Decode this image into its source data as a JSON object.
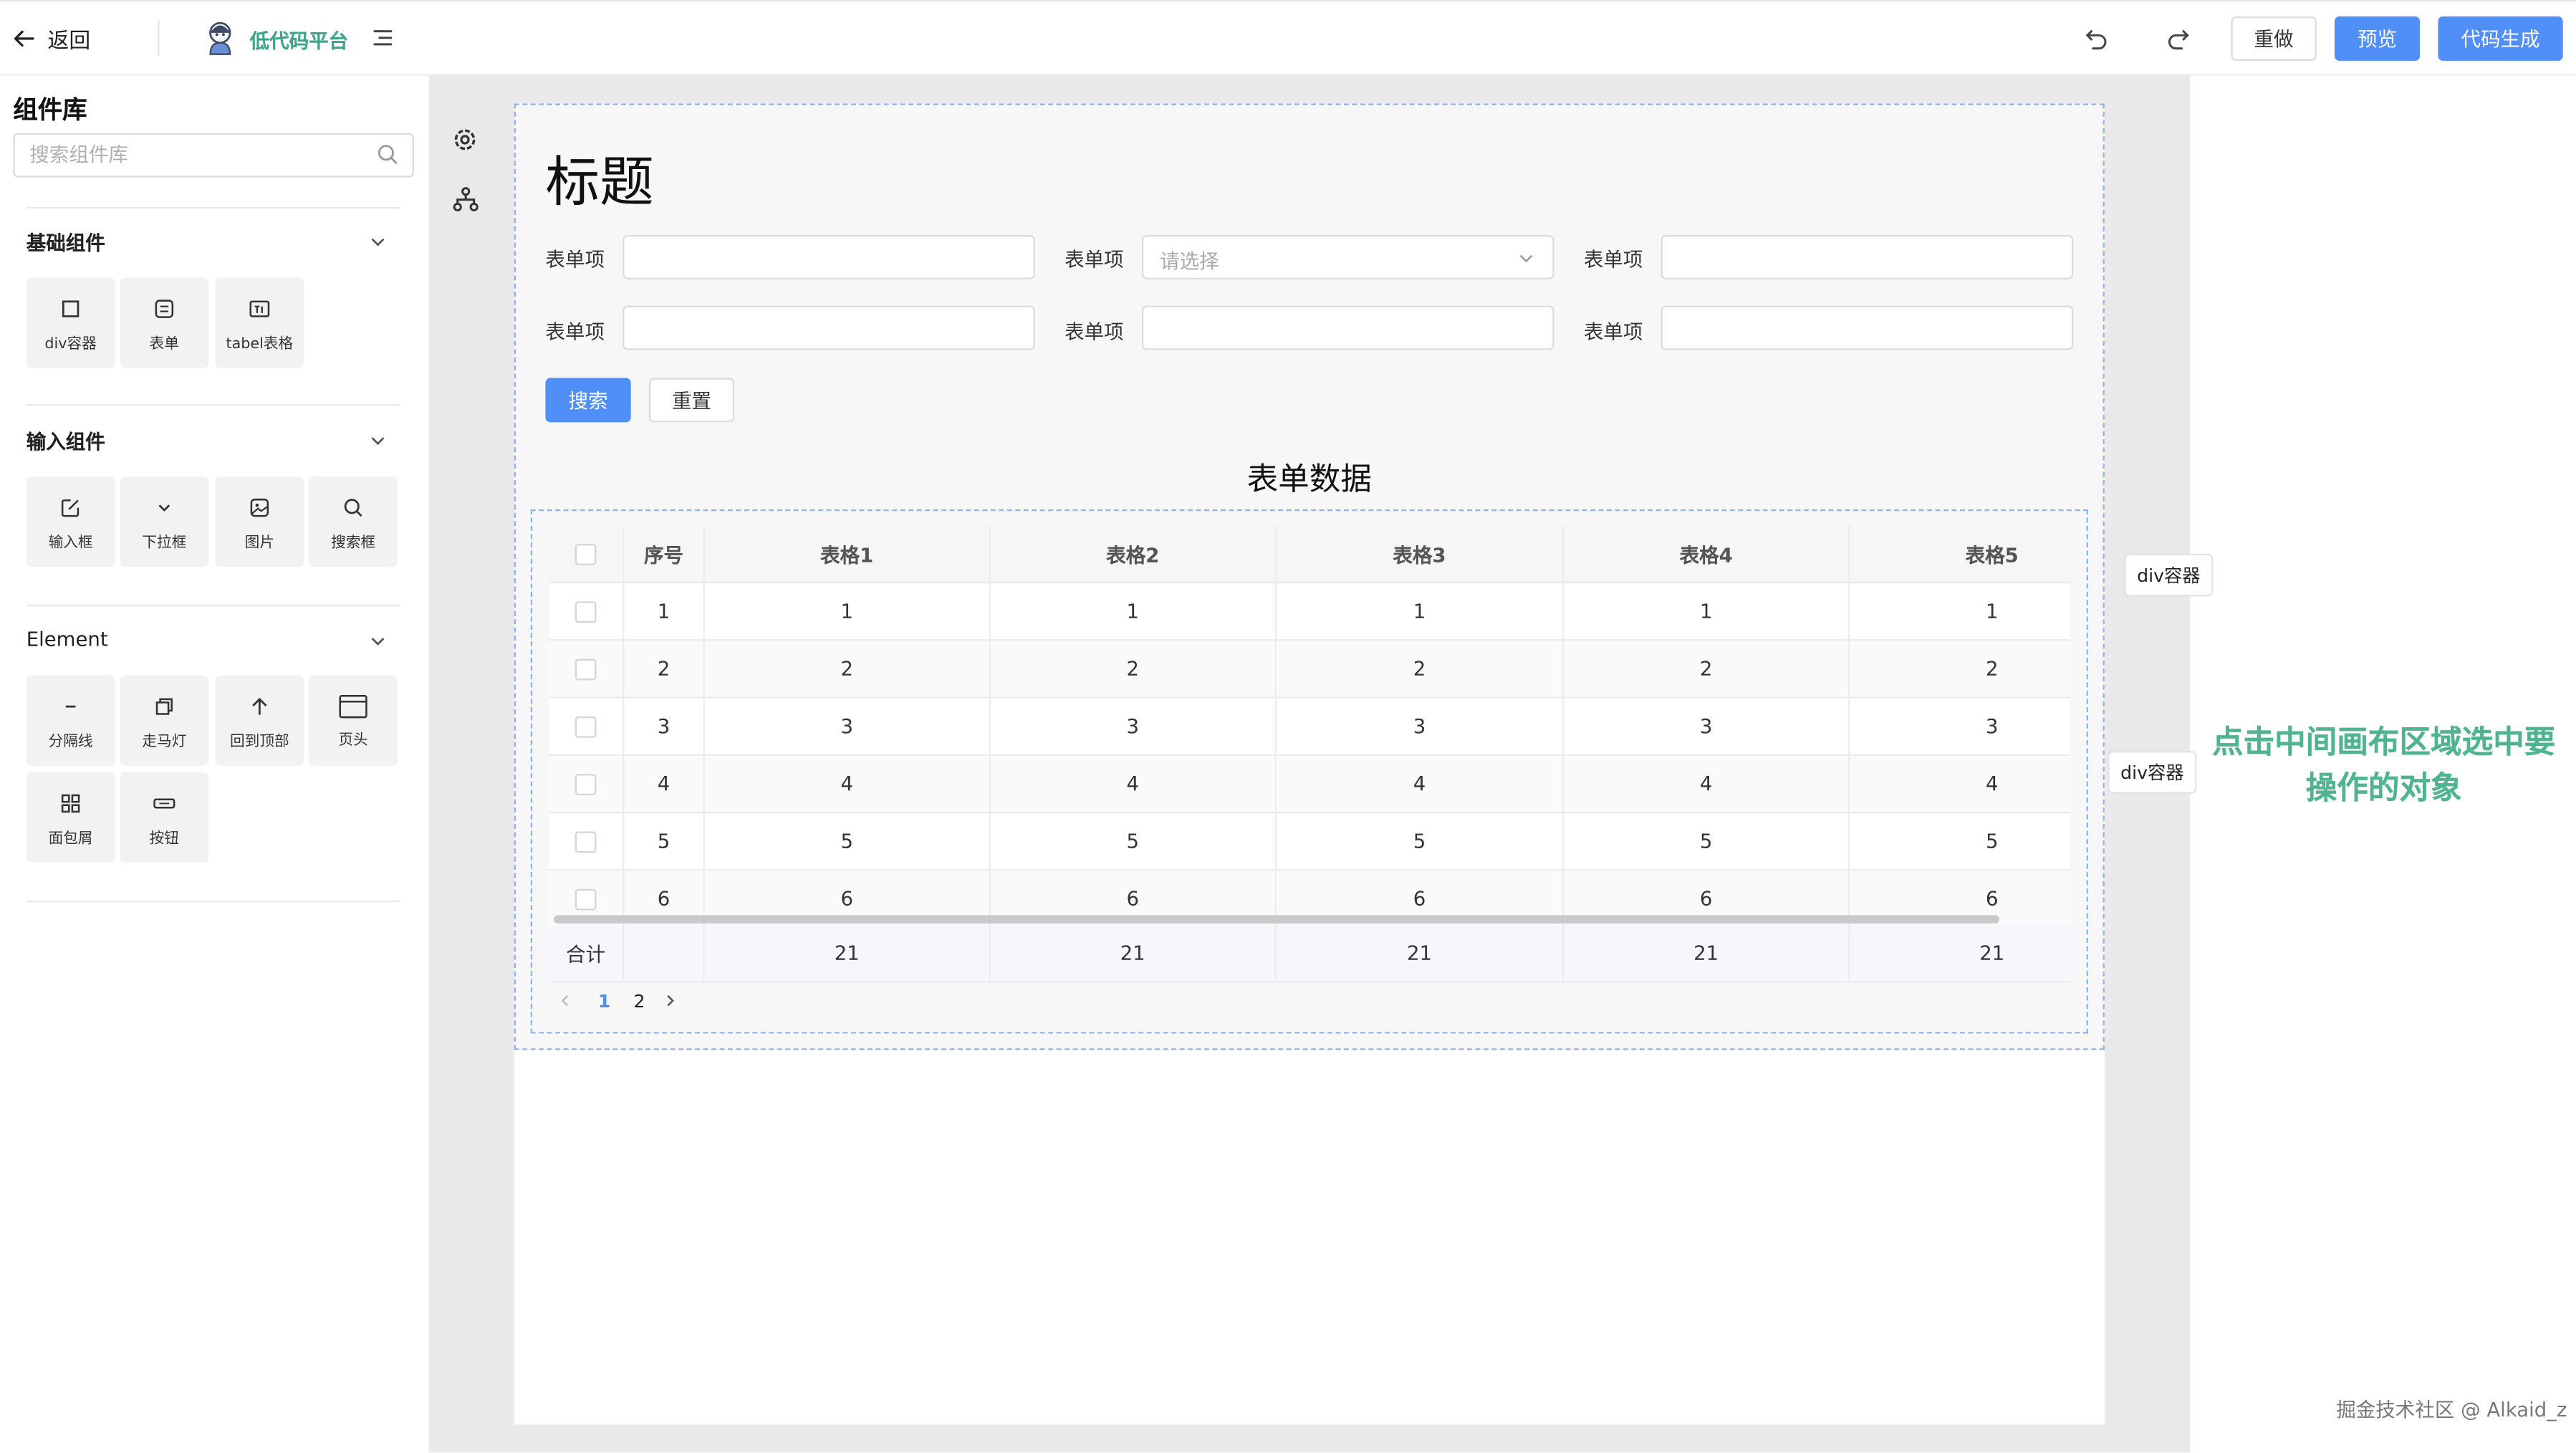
{
  "header": {
    "back_label": "返回",
    "app_name": "低代码平台",
    "buttons": {
      "redo_text": "重做",
      "preview": "预览",
      "codegen": "代码生成"
    }
  },
  "sidebar": {
    "title": "组件库",
    "search_placeholder": "搜索组件库",
    "sections": [
      {
        "title": "基础组件",
        "items": [
          "div容器",
          "表单",
          "tabel表格"
        ]
      },
      {
        "title": "输入组件",
        "items": [
          "输入框",
          "下拉框",
          "图片",
          "搜索框"
        ]
      },
      {
        "title": "Element",
        "items": [
          "分隔线",
          "走马灯",
          "回到顶部",
          "页头",
          "面包屑",
          "按钮"
        ]
      }
    ]
  },
  "canvas": {
    "page_title": "标题",
    "form": {
      "label": "表单项",
      "select_placeholder": "请选择",
      "search_button": "搜索",
      "reset_button": "重置"
    },
    "table_title": "表单数据",
    "table": {
      "headers": [
        "序号",
        "表格1",
        "表格2",
        "表格3",
        "表格4",
        "表格5"
      ],
      "rows": [
        [
          "1",
          "1",
          "1",
          "1",
          "1",
          "1"
        ],
        [
          "2",
          "2",
          "2",
          "2",
          "2",
          "2"
        ],
        [
          "3",
          "3",
          "3",
          "3",
          "3",
          "3"
        ],
        [
          "4",
          "4",
          "4",
          "4",
          "4",
          "4"
        ],
        [
          "5",
          "5",
          "5",
          "5",
          "5",
          "5"
        ],
        [
          "6",
          "6",
          "6",
          "6",
          "6",
          "6"
        ]
      ],
      "footer": [
        "合计",
        "",
        "21",
        "21",
        "21",
        "21",
        "21"
      ]
    },
    "pagination": {
      "pages": [
        "1",
        "2"
      ],
      "current": "1"
    },
    "tags": [
      "div容器",
      "div容器"
    ]
  },
  "hint": {
    "line1": "点击中间画布区域选中要",
    "line2": "操作的对象"
  },
  "watermark": "掘金技术社区 @ Alkaid_z",
  "colors": {
    "primary": "#4f8ff7",
    "hint": "#4fb48f",
    "brand": "#3aa58a",
    "selection": "#8fb3f2"
  }
}
